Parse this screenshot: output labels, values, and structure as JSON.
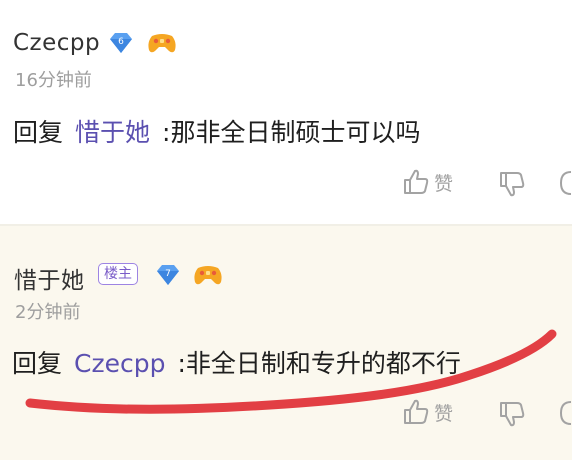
{
  "comments": [
    {
      "username": "Czecpp",
      "level": "6",
      "time": "16分钟前",
      "reply_prefix": "回复",
      "reply_to": "惜于她",
      "text": ":那非全日制硕士可以吗",
      "like_label": "赞",
      "icons": [
        "diamond-level-badge-icon",
        "gamepad-badge-icon",
        "thumbs-up-icon",
        "thumbs-down-icon",
        "comment-icon"
      ]
    },
    {
      "username": "惜于她",
      "owner_tag": "楼主",
      "level": "7",
      "time": "2分钟前",
      "reply_prefix": "回复",
      "reply_to": "Czecpp",
      "text": ":非全日制和专升的都不行",
      "like_label": "赞",
      "icons": [
        "diamond-level-badge-icon",
        "gamepad-badge-icon",
        "thumbs-up-icon",
        "thumbs-down-icon",
        "comment-icon"
      ]
    }
  ],
  "colors": {
    "mention": "#5b50b0",
    "owner_tag_border": "#9d84e3",
    "highlight_background": "#fbf8ee",
    "annotation_stroke": "#e0353a",
    "diamond": "#5aa0f0"
  }
}
